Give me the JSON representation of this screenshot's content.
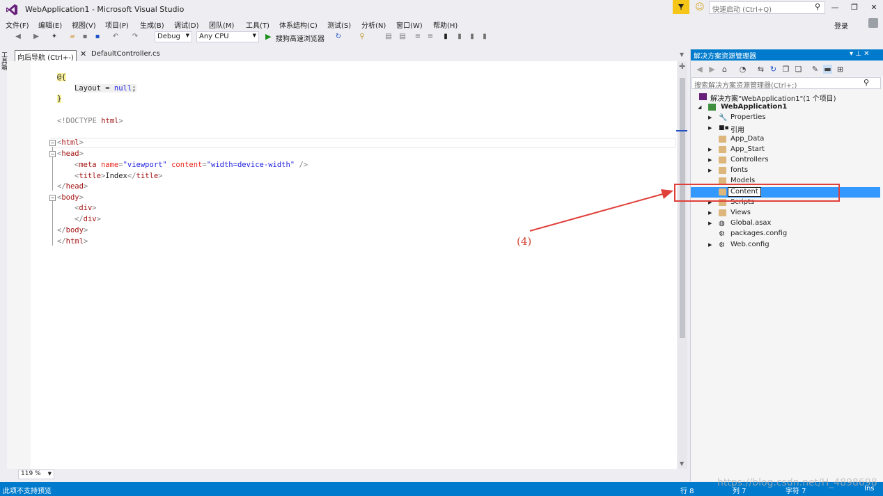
{
  "window": {
    "title": "WebApplication1 - Microsoft Visual Studio",
    "quick_launch_placeholder": "快速启动 (Ctrl+Q)",
    "login_label": "登录"
  },
  "menu": [
    "文件(F)",
    "编辑(E)",
    "视图(V)",
    "项目(P)",
    "生成(B)",
    "调试(D)",
    "团队(M)",
    "工具(T)",
    "体系结构(C)",
    "测试(S)",
    "分析(N)",
    "窗口(W)",
    "帮助(H)"
  ],
  "toolbar": {
    "config": "Debug",
    "platform": "Any CPU",
    "run_label": "搜狗高速浏览器"
  },
  "tabs": {
    "tooltip": "向后导航 (Ctrl+-)",
    "active_file": "DefaultController.cs"
  },
  "left_strip_label": "工具箱",
  "code": {
    "l1": "@{",
    "l2a": "Layout",
    "l2b": " = ",
    "l2c": "null",
    "l2d": ";",
    "l3": "}",
    "l4a": "<!DOCTYPE ",
    "l4b": "html",
    "l4c": ">",
    "l5a": "<",
    "l5b": "html",
    "l5c": ">",
    "l6a": "<",
    "l6b": "head",
    "l6c": ">",
    "l7a": "<",
    "l7b": "meta",
    "l7c": " name",
    "l7d": "=",
    "l7e": "\"viewport\"",
    "l7f": " content",
    "l7g": "=",
    "l7h": "\"width=device-width\"",
    "l7i": " />",
    "l8a": "<",
    "l8b": "title",
    "l8c": ">",
    "l8d": "Index",
    "l8e": "</",
    "l8f": "title",
    "l8g": ">",
    "l9a": "</",
    "l9b": "head",
    "l9c": ">",
    "l10a": "<",
    "l10b": "body",
    "l10c": ">",
    "l11a": "<",
    "l11b": "div",
    "l11c": ">",
    "l12a": "</",
    "l12b": "div",
    "l12c": ">",
    "l13a": "</",
    "l13b": "body",
    "l13c": ">",
    "l14a": "</",
    "l14b": "html",
    "l14c": ">"
  },
  "zoom": "119 %",
  "solution_explorer": {
    "title": "解决方案资源管理器",
    "search_placeholder": "搜索解决方案资源管理器(Ctrl+;)",
    "solution": "解决方案\"WebApplication1\"(1 个项目)",
    "project": "WebApplication1",
    "items": [
      "Properties",
      "引用",
      "App_Data",
      "App_Start",
      "Controllers",
      "fonts",
      "Models",
      "Content",
      "Scripts",
      "Views",
      "Global.asax",
      "packages.config",
      "Web.config"
    ]
  },
  "annotation": {
    "step": "(4)",
    "color": "#e0403a"
  },
  "status": {
    "message": "此项不支持预览",
    "line": "行 8",
    "col": "列 7",
    "char": "字符 7",
    "mode": "Ins"
  },
  "watermark": "https://blog.csdn.net/H_4898698",
  "colors": {
    "accent": "#007acc",
    "selection": "#3399ff",
    "annotation_red": "#e0403a"
  }
}
